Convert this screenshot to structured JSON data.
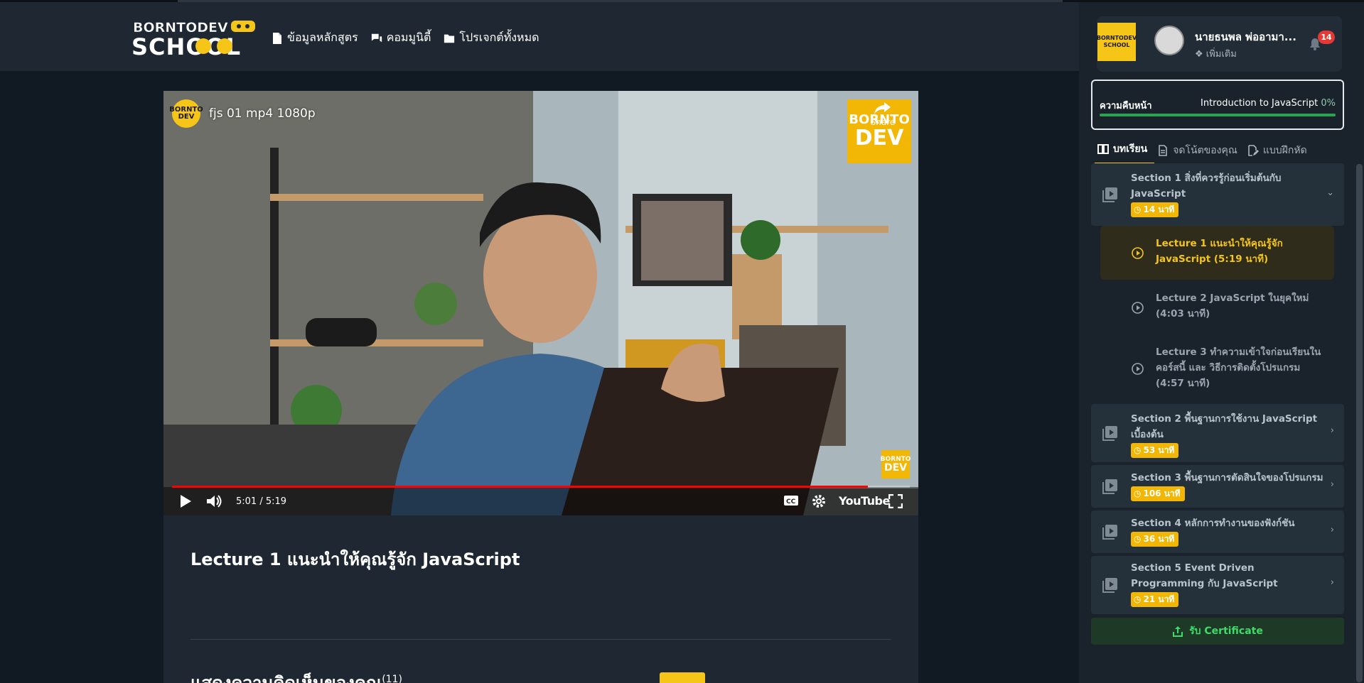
{
  "header": {
    "logo_top": "BORNTODEV",
    "logo_bottom": "SCHOOL",
    "nav": [
      {
        "label": "ข้อมูลหลักสูตร",
        "icon": "document-icon"
      },
      {
        "label": "คอมมูนิตี้",
        "icon": "chat-bubbles-icon"
      },
      {
        "label": "โปรเจกต์ทั้งหมด",
        "icon": "folder-icon"
      }
    ]
  },
  "video": {
    "channel_avatar_text": "BORNTO DEV",
    "title": "fjs 01 mp4 1080p",
    "share_label": "Share",
    "brand_top": "BORNTO",
    "brand_bottom": "DEV",
    "time": "5:01 / 5:19",
    "progress": 0.943,
    "platform": "YouTube",
    "accent": "#ff0000"
  },
  "lecture": {
    "title": "Lecture 1 แนะนำให้คุณรู้จัก JavaScript",
    "comments_heading": "แสดงความคิดเห็นของคุณ",
    "comments_count": "(11)"
  },
  "sidebar": {
    "school_badge": "BORNTODEV SCHOOL",
    "user_name": "นายธนพล พ่ออามา...",
    "user_more": "เพิ่มเติม",
    "notification_count": "14",
    "progress_label": "ความคืบหน้า",
    "course_name": "Introduction to JavaScript",
    "course_percent": "0%",
    "tabs": [
      {
        "label": "บทเรียน",
        "icon": "book-icon",
        "active": true
      },
      {
        "label": "จดโน้ตของคุณ",
        "icon": "note-icon",
        "active": false
      },
      {
        "label": "แบบฝึกหัด",
        "icon": "pencil-file-icon",
        "active": false
      }
    ],
    "sections": [
      {
        "title": "Section 1 สิ่งที่ควรรู้ก่อนเริ่มต้นกับ JavaScript",
        "duration": "14 นาที",
        "expanded": true
      },
      {
        "title": "Section 2 พื้นฐานการใช้งาน JavaScript เบื้องต้น",
        "duration": "53 นาที",
        "expanded": false
      },
      {
        "title": "Section 3 พื้นฐานการตัดสินใจของโปรแกรม",
        "duration": "106 นาที",
        "expanded": false
      },
      {
        "title": "Section 4 หลักการทำงานของฟังก์ชัน",
        "duration": "36 นาที",
        "expanded": false
      },
      {
        "title": "Section 5 Event Driven Programming กับ JavaScript",
        "duration": "21 นาที",
        "expanded": false
      }
    ],
    "lectures": [
      {
        "title": "Lecture 1 แนะนำให้คุณรู้จัก JavaScript (5:19 นาที)",
        "active": true
      },
      {
        "title": "Lecture 2 JavaScript ในยุคใหม่ (4:03 นาที)",
        "active": false
      },
      {
        "title": "Lecture 3 ทำความเข้าใจก่อนเรียนในคอร์สนี้ และ วิธีการติดตั้งโปรแกรม (4:57 นาที)",
        "active": false
      }
    ],
    "certificate_label": "รับ Certificate"
  },
  "colors": {
    "brand_yellow": "#f5c518",
    "success_green": "#3ddc6a",
    "panel": "#1f2832"
  }
}
